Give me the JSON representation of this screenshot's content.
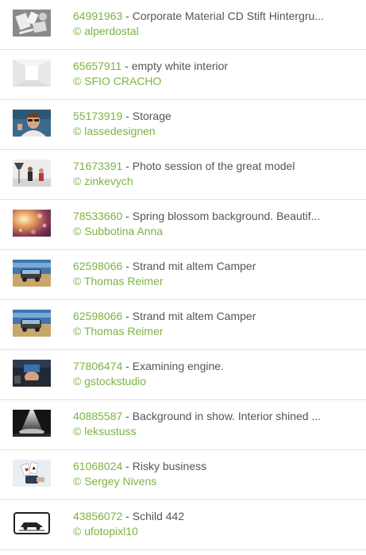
{
  "items": [
    {
      "id": "64991963",
      "sep": " - ",
      "title": "Corporate Material CD Stift Hintergru...",
      "author": "© alperdostal",
      "thumb": "stationery"
    },
    {
      "id": "65657911",
      "sep": " - ",
      "title": "empty white interior",
      "author": "© SFIO CRACHO",
      "thumb": "white-room"
    },
    {
      "id": "55173919",
      "sep": " - ",
      "title": "Storage",
      "author": "© lassedesignen",
      "thumb": "man-glasses"
    },
    {
      "id": "71673391",
      "sep": " - ",
      "title": "Photo session of the great model",
      "author": "© zinkevych",
      "thumb": "photo-studio"
    },
    {
      "id": "78533660",
      "sep": " - ",
      "title": "Spring blossom background. Beautif...",
      "author": "© Subbotina Anna",
      "thumb": "blossom"
    },
    {
      "id": "62598066",
      "sep": " - ",
      "title": "Strand mit altem Camper",
      "author": "© Thomas Reimer",
      "thumb": "camper-beach"
    },
    {
      "id": "62598066",
      "sep": " - ",
      "title": "Strand mit altem Camper",
      "author": "© Thomas Reimer",
      "thumb": "camper-beach"
    },
    {
      "id": "77806474",
      "sep": " - ",
      "title": "Examining engine.",
      "author": "© gstockstudio",
      "thumb": "engine"
    },
    {
      "id": "40885587",
      "sep": " - ",
      "title": "Background in show. Interior shined ...",
      "author": "© leksustuss",
      "thumb": "spotlight-stage"
    },
    {
      "id": "61068024",
      "sep": " - ",
      "title": "Risky business",
      "author": "© Sergey Nivens",
      "thumb": "cards-hand"
    },
    {
      "id": "43856072",
      "sep": " - ",
      "title": "Schild 442",
      "author": "© ufotopixl10",
      "thumb": "traffic-sign"
    }
  ]
}
